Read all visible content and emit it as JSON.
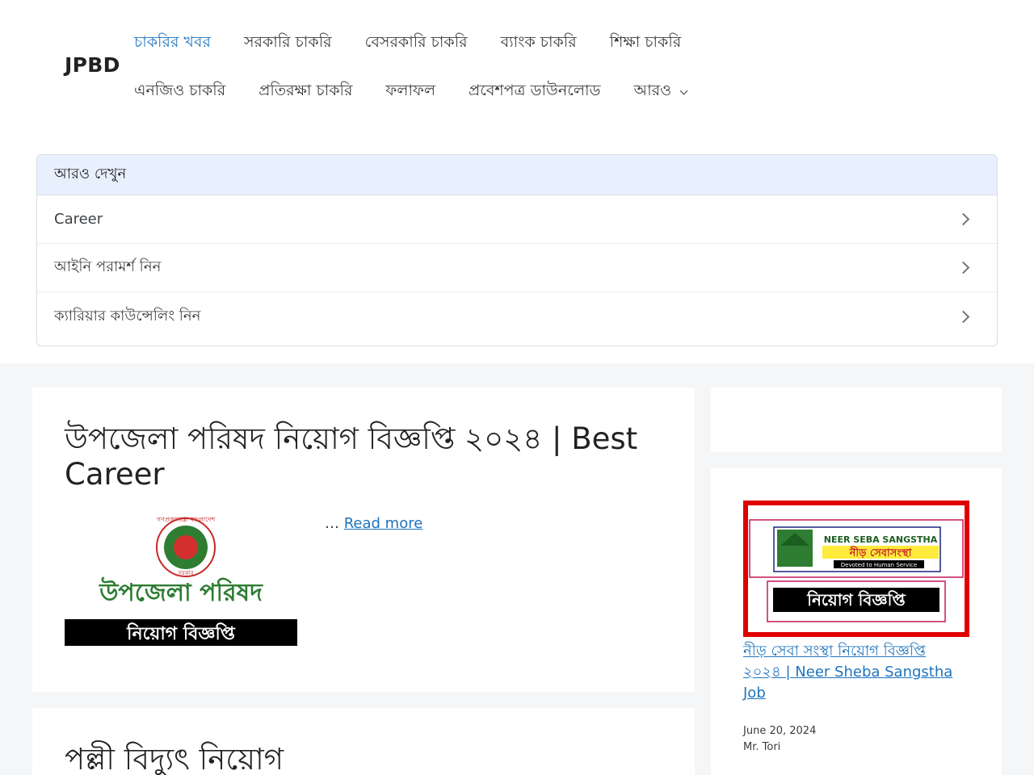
{
  "site": {
    "logo": "JPBD"
  },
  "nav": {
    "row1": [
      "চাকরির খবর",
      "সরকারি চাকরি",
      "বেসরকারি চাকরি",
      "ব্যাংক চাকরি",
      "শিক্ষা চাকরি"
    ],
    "row2": [
      "এনজিও চাকরি",
      "প্রতিরক্ষা চাকরি",
      "ফলাফল",
      "প্রবেশপত্র ডাউনলোড",
      "আরও"
    ]
  },
  "related": {
    "heading": "আরও দেখুন",
    "items": [
      "Career",
      "আইনি পরামর্শ নিন",
      "ক্যারিয়ার কাউন্সেলিং নিন"
    ]
  },
  "post1": {
    "title": "উপজেলা পরিষদ নিয়োগ বিজ্ঞপ্তি ২০২৪ | Best Career",
    "thumb_top": "গণপ্রজাতন্ত্রী বাংলাদেশ",
    "thumb_sub": "সরকার",
    "thumb_main": "উপজেলা পরিষদ",
    "thumb_banner": "নিয়োগ বিজ্ঞপ্তি",
    "ellipsis": "…",
    "read_more": "Read more"
  },
  "post2": {
    "title": "পল্লী বিদ্যুৎ নিয়োগ"
  },
  "sidebar": {
    "thumb_en": "NEER SEBA SANGSTHA",
    "thumb_bn": "নীড় সেবাসংস্থা",
    "thumb_tag": "Devoted to Human Service",
    "thumb_banner": "নিয়োগ বিজ্ঞপ্তি",
    "post_title": "নীড় সেবা সংস্থা নিয়োগ বিজ্ঞপ্তি ২০২৪ | Neer Sheba Sangstha Job",
    "date": "June 20, 2024",
    "author": "Mr. Tori"
  },
  "colors": {
    "link": "#1e73be",
    "related_head": "#e8f0fe",
    "content_bg": "#f5f6f8"
  }
}
